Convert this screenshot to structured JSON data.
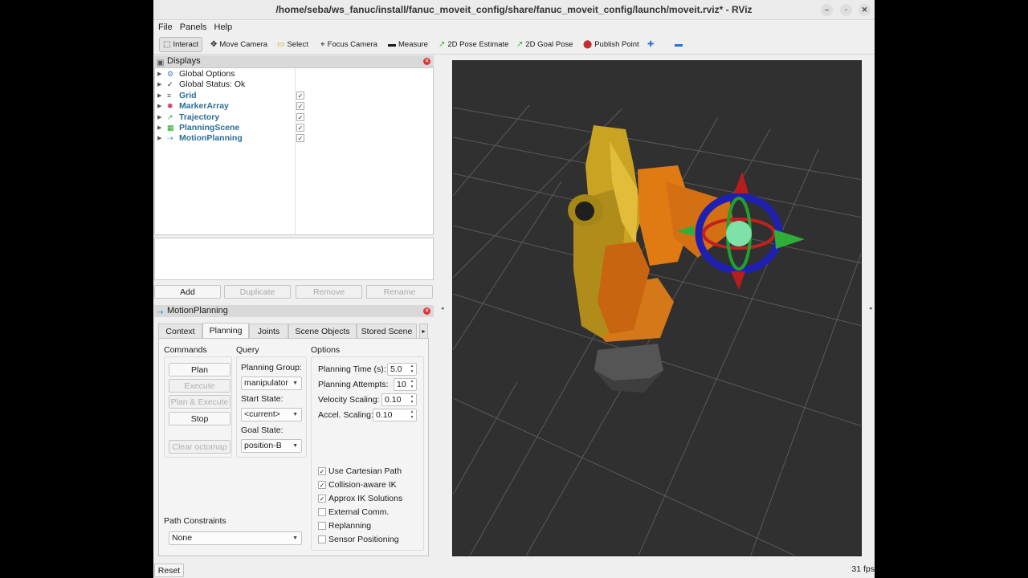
{
  "window": {
    "title": "/home/seba/ws_fanuc/install/fanuc_moveit_config/share/fanuc_moveit_config/launch/moveit.rviz* - RViz",
    "controls": {
      "minimize": "–",
      "maximize": "◦",
      "close": "✕"
    }
  },
  "menu": {
    "file": "File",
    "panels": "Panels",
    "help": "Help"
  },
  "toolbar": {
    "interact": "Interact",
    "move_camera": "Move Camera",
    "select": "Select",
    "focus_camera": "Focus Camera",
    "measure": "Measure",
    "pose_estimate": "2D Pose Estimate",
    "goal_pose": "2D Goal Pose",
    "publish_point": "Publish Point",
    "icons": [
      "cursor-icon",
      "move-camera-icon",
      "select-icon",
      "focus-camera-icon",
      "ruler-icon",
      "arrow-green-icon",
      "arrow-green-icon",
      "map-pin-icon",
      "plus-icon",
      "minus-icon"
    ]
  },
  "displays": {
    "title": "Displays",
    "items": [
      {
        "label": "Global Options",
        "icon": "gear-icon",
        "checked": null,
        "highlight": false
      },
      {
        "label": "Global Status: Ok",
        "icon": "check-icon",
        "checked": null,
        "highlight": false
      },
      {
        "label": "Grid",
        "icon": "grid-icon",
        "checked": true,
        "highlight": true
      },
      {
        "label": "MarkerArray",
        "icon": "marker-icon",
        "checked": true,
        "highlight": true
      },
      {
        "label": "Trajectory",
        "icon": "trajectory-icon",
        "checked": true,
        "highlight": true
      },
      {
        "label": "PlanningScene",
        "icon": "scene-icon",
        "checked": true,
        "highlight": true
      },
      {
        "label": "MotionPlanning",
        "icon": "motion-icon",
        "checked": true,
        "highlight": true
      }
    ],
    "buttons": {
      "add": "Add",
      "duplicate": "Duplicate",
      "remove": "Remove",
      "rename": "Rename"
    }
  },
  "motion_planning": {
    "title": "MotionPlanning",
    "tabs": [
      "Context",
      "Planning",
      "Joints",
      "Scene Objects",
      "Stored Scene"
    ],
    "selected_tab": "Planning",
    "commands": {
      "title": "Commands",
      "plan": "Plan",
      "execute": "Execute",
      "plan_execute": "Plan & Execute",
      "stop": "Stop",
      "clear_octomap": "Clear octomap"
    },
    "query": {
      "title": "Query",
      "planning_group_label": "Planning Group:",
      "planning_group": "manipulator",
      "start_state_label": "Start State:",
      "start_state": "<current>",
      "goal_state_label": "Goal State:",
      "goal_state": "position-B"
    },
    "options": {
      "title": "Options",
      "planning_time_label": "Planning Time (s):",
      "planning_time": "5.0",
      "planning_attempts_label": "Planning Attempts:",
      "planning_attempts": "10",
      "velocity_scaling_label": "Velocity Scaling:",
      "velocity_scaling": "0.10",
      "accel_scaling_label": "Accel. Scaling:",
      "accel_scaling": "0.10",
      "checkboxes": [
        {
          "label": "Use Cartesian Path",
          "checked": true
        },
        {
          "label": "Collision-aware IK",
          "checked": true
        },
        {
          "label": "Approx IK Solutions",
          "checked": true
        },
        {
          "label": "External Comm.",
          "checked": false
        },
        {
          "label": "Replanning",
          "checked": false
        },
        {
          "label": "Sensor Positioning",
          "checked": false
        }
      ]
    },
    "path_constraints": {
      "title": "Path Constraints",
      "value": "None"
    }
  },
  "status": {
    "reset": "Reset",
    "fps": "31 fps"
  }
}
